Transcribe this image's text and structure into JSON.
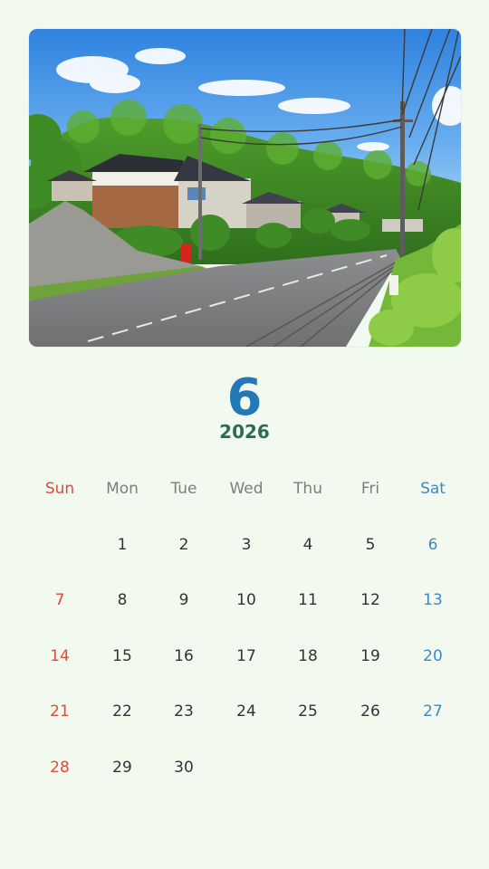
{
  "calendar": {
    "month": "6",
    "year": "2026",
    "weekdays": [
      "Sun",
      "Mon",
      "Tue",
      "Wed",
      "Thu",
      "Fri",
      "Sat"
    ],
    "weeks": [
      [
        "",
        "1",
        "2",
        "3",
        "4",
        "5",
        "6"
      ],
      [
        "7",
        "8",
        "9",
        "10",
        "11",
        "12",
        "13"
      ],
      [
        "14",
        "15",
        "16",
        "17",
        "18",
        "19",
        "20"
      ],
      [
        "21",
        "22",
        "23",
        "24",
        "25",
        "26",
        "27"
      ],
      [
        "28",
        "29",
        "30",
        "",
        "",
        "",
        ""
      ]
    ]
  },
  "colors": {
    "background": "#f2faef",
    "month": "#2379b7",
    "year": "#2e6b52",
    "sunday": "#e14a3d",
    "saturday": "#3d88c8",
    "weekday_label": "#7d7d7d",
    "day": "#333333"
  }
}
